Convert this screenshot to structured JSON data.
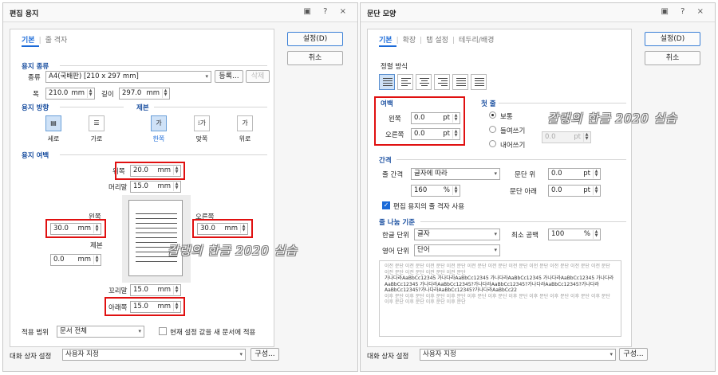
{
  "left": {
    "title": "편집 용지",
    "title_controls": "▣ ? ×",
    "tabs": [
      "기본",
      "줄 격자"
    ],
    "buttons": {
      "ok": "설정(D)",
      "cancel": "취소"
    },
    "paper_type": {
      "section": "용지 종류",
      "kind_label": "종류",
      "kind_value": "A4(국배판) [210 x 297 mm]",
      "register": "등록...",
      "delete": "삭제",
      "width_label": "폭",
      "width_value": "210.0",
      "height_label": "길이",
      "height_value": "297.0",
      "unit": "mm"
    },
    "orientation": {
      "section": "용지 방향",
      "portrait": "세로",
      "landscape": "가로"
    },
    "binding": {
      "section": "제본",
      "one_side": "한쪽",
      "facing": "맞쪽",
      "top": "위로"
    },
    "margin": {
      "section": "용지 여백",
      "top_label": "위쪽",
      "top_value": "20.0",
      "header_label": "머리말",
      "header_value": "15.0",
      "left_label": "왼쪽",
      "left_value": "30.0",
      "right_label": "오른쪽",
      "right_value": "30.0",
      "gutter_label": "제본",
      "gutter_value": "0.0",
      "footer_label": "꼬리말",
      "footer_value": "15.0",
      "bottom_label": "아래쪽",
      "bottom_value": "15.0",
      "unit": "mm"
    },
    "apply": {
      "label": "적용 범위",
      "value": "문서 전체",
      "check": "현재 설정 값을 새 문서에 적용"
    },
    "bottom": {
      "label": "대화 상자 설정",
      "value": "사용자 지정",
      "btn": "구성..."
    },
    "watermark": "갈랭의 한글 2020 실습"
  },
  "right": {
    "title": "문단 모양",
    "title_controls": "▣ ? ×",
    "tabs": [
      "기본",
      "확장",
      "탭 설정",
      "테두리/배경"
    ],
    "buttons": {
      "ok": "설정(D)",
      "cancel": "취소"
    },
    "align": {
      "section": "정렬 방식"
    },
    "margin": {
      "section": "여백",
      "left_label": "왼쪽",
      "left_value": "0.0",
      "right_label": "오른쪽",
      "right_value": "0.0",
      "unit": "pt"
    },
    "first_line": {
      "section": "첫 줄",
      "normal": "보통",
      "indent": "들여쓰기",
      "outdent": "내어쓰기",
      "value": "0.0",
      "unit": "pt"
    },
    "spacing": {
      "section": "간격",
      "line_label": "줄 간격",
      "line_value": "글자에 따라",
      "line_pct": "160",
      "pct_unit": "%",
      "above_label": "문단 위",
      "above_value": "0.0",
      "below_label": "문단 아래",
      "below_value": "0.0",
      "unit": "pt",
      "grid_check": "편집 용지의 줄 격자 사용"
    },
    "break": {
      "section": "줄 나눔 기준",
      "korean_label": "한글 단위",
      "korean_value": "글자",
      "min_space_label": "최소 공백",
      "min_space_value": "100",
      "english_label": "영어 단위",
      "english_value": "단어",
      "pct_unit": "%"
    },
    "sample": {
      "prev": "이전 문단 이전 문단 이전 문단 이전 문단 이전 문단 이전 문단 이전 문단 이전 문단 이전 문단 이전 문단 이전 문단 이전 문단 이전 문단 이전 문단 이전 문단",
      "cur": "가나다라AaBbCc12345 가나다라AaBbCc12345 가나다라AaBbCc12345 가나다라AaBbCc12345 가나다라AaBbCc12345 가나다라AaBbCc12345?가나다라AaBbCc12345?가나다라AaBbCc12345?가나다라AaBbCc12345?가나다라AaBbCc12345?가나다라AaBbCc22",
      "next": "이후 문단 이후 문단 이후 문단 이후 문단 이후 문단 이후 문단 이후 문단 이후 문단 이후 문단 이후 문단 이후 문단 이후 문단 이후 문단 이후 문단 이후 문단"
    },
    "bottom": {
      "label": "대화 상자 설정",
      "value": "사용자 지정",
      "btn": "구성..."
    },
    "watermark": "갈랭의 한글 2020 실습"
  }
}
